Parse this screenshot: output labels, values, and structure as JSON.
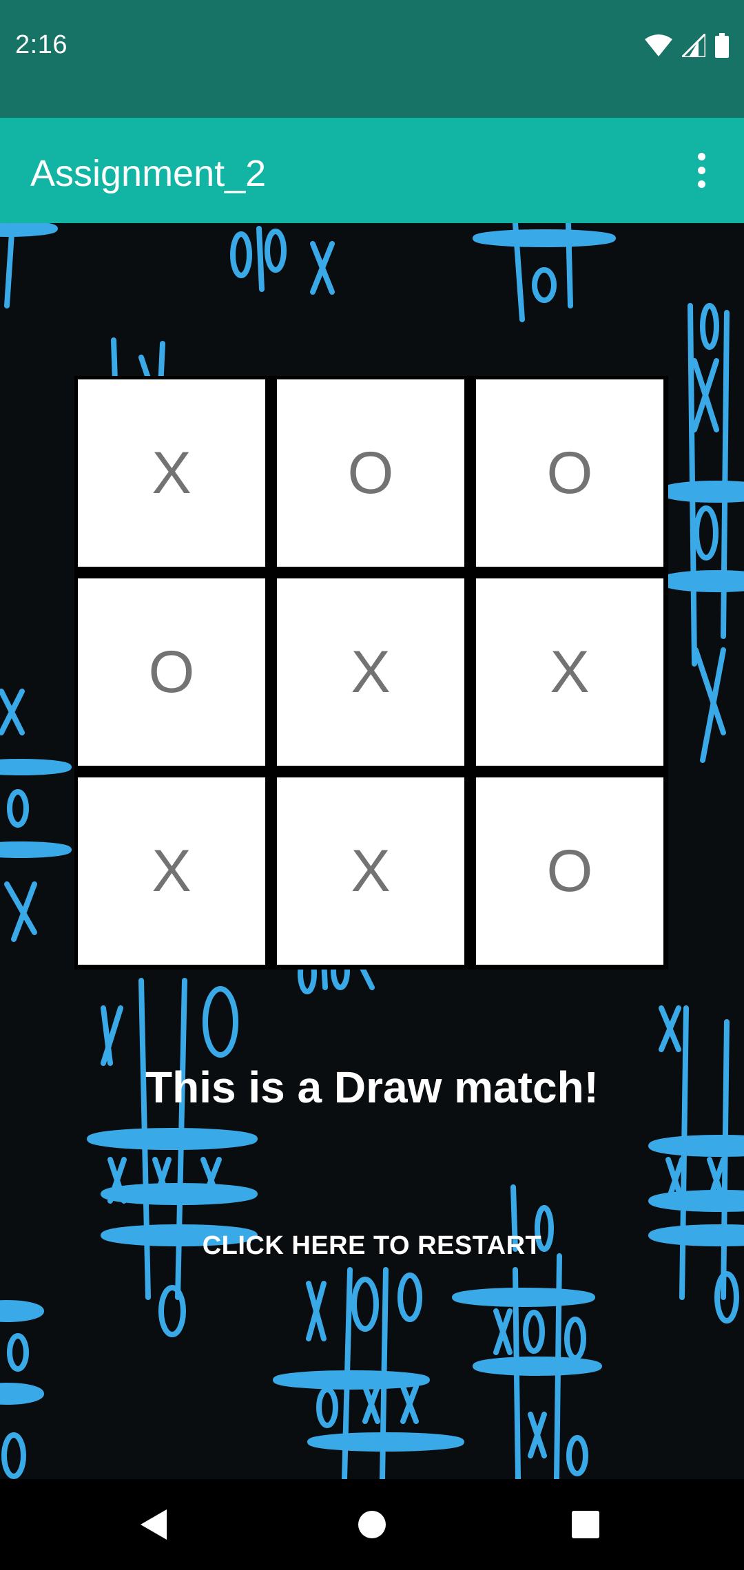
{
  "status_bar": {
    "time": "2:16",
    "icons": [
      "wifi-icon",
      "cell-signal-icon",
      "battery-icon"
    ]
  },
  "app_bar": {
    "title": "Assignment_2",
    "menu_icon": "more-vert-icon"
  },
  "board": {
    "cells": [
      "X",
      "O",
      "O",
      "O",
      "X",
      "X",
      "X",
      "X",
      "O"
    ]
  },
  "result": {
    "message": "This is a Draw match!"
  },
  "restart": {
    "label": "CLICK HERE TO RESTART"
  },
  "nav_bar": {
    "icons": [
      "back-icon",
      "home-icon",
      "recents-icon"
    ]
  },
  "colors": {
    "status_bar": "#167365",
    "app_bar": "#12b4a4",
    "doodle_blue": "#3aa9e8",
    "cell_text": "#737373"
  }
}
